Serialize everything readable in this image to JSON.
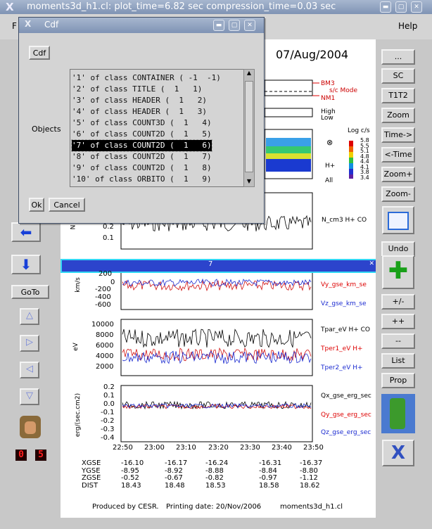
{
  "app": {
    "title": "moments3d_h1.cl: plot_time=6.82 sec  compression_time=0.03 sec"
  },
  "menubar": {
    "file_label": "F",
    "help_label": "Help"
  },
  "plot": {
    "date": "07/Aug/2004",
    "panel_tag": "7",
    "mode_labels": [
      "BM3",
      "s/c Mode",
      "NM1"
    ],
    "energy_labels": [
      "High",
      "Low"
    ],
    "spectrogram_labels": [
      "H+",
      "⊗",
      "All"
    ],
    "colorbar_title": "Log c/s",
    "colorbar_ticks": [
      "5.8",
      "5.5",
      "5.1",
      "4.8",
      "4.4",
      "4.1",
      "3.8",
      "3.4"
    ],
    "density_units": "N",
    "density_legend": "N_cm3   H+ CO",
    "vel_units": "km/s",
    "vel_legend": [
      "Vy_gse_km_se",
      "Vz_gse_km_se"
    ],
    "temp_units": "eV",
    "temp_legend": [
      "Tpar_eV  H+ CO",
      "Tper1_eV  H+",
      "Tper2_eV  H+"
    ],
    "flux_units": "erg/(sec.cm2)",
    "flux_legend": [
      "Qx_gse_erg_sec",
      "Qy_gse_erg_sec",
      "Qz_gse_erg_sec"
    ],
    "xticks": [
      "22:50",
      "23:00",
      "23:10",
      "23:20",
      "23:30",
      "23:40",
      "23:50"
    ],
    "ephem_rows": [
      {
        "label": "XGSE",
        "values": [
          "-16.10",
          "-16.17",
          "-16.24",
          "-16.31",
          "-16.37"
        ]
      },
      {
        "label": "YGSE",
        "values": [
          "-8.95",
          "-8.92",
          "-8.88",
          "-8.84",
          "-8.80"
        ]
      },
      {
        "label": "ZGSE",
        "values": [
          "-0.52",
          "-0.67",
          "-0.82",
          "-0.97",
          "-1.12"
        ]
      },
      {
        "label": "DIST",
        "values": [
          "18.43",
          "18.48",
          "18.53",
          "18.58",
          "18.62"
        ]
      }
    ],
    "footer_produced": "Produced by  CESR.",
    "footer_date": "Printing date: 20/Nov/2006",
    "footer_file": "moments3d_h1.cl"
  },
  "chart_data": [
    {
      "type": "line",
      "ylabel": "N",
      "yticks": [
        "0.2",
        "0.1"
      ]
    },
    {
      "type": "line",
      "ylabel": "km/s",
      "yticks": [
        "200",
        "0",
        "-200",
        "-400",
        "-600"
      ]
    },
    {
      "type": "line",
      "ylabel": "eV",
      "yticks": [
        "10000",
        "8000",
        "6000",
        "4000",
        "2000"
      ]
    },
    {
      "type": "line",
      "ylabel": "erg/(sec.cm2)",
      "yticks": [
        "0.2",
        "0.1",
        "0.0",
        "-0.1",
        "-0.2",
        "-0.3",
        "-0.4"
      ]
    }
  ],
  "leftcol": {
    "goto_label": "GoTo",
    "counter": [
      "0",
      "5"
    ]
  },
  "rightcol": {
    "buttons": [
      "...",
      "SC",
      "T1T2",
      "Zoom",
      "Time->",
      "<-Time",
      "Zoom+",
      "Zoom-"
    ],
    "buttons2": [
      "Undo"
    ],
    "buttons3": [
      "+/-",
      "++",
      "--",
      "List",
      "Prop"
    ]
  },
  "dialog": {
    "title": "Cdf",
    "cdf_button": "Cdf",
    "objects_label": "Objects",
    "items": [
      "'1' of class CONTAINER ( -1  -1)",
      "'2' of class TITLE (  1   1)",
      "'3' of class HEADER (  1   2)",
      "'4' of class HEADER (  1   3)",
      "'5' of class COUNT3D (  1   4)",
      "'6' of class COUNT2D (  1   5)",
      "'7' of class COUNT2D (  1   6)",
      "'8' of class COUNT2D (  1   7)",
      "'9' of class COUNT2D (  1   8)",
      "'10' of class ORBITO (  1   9)"
    ],
    "selected_index": 6,
    "ok_label": "Ok",
    "cancel_label": "Cancel"
  },
  "colors": {
    "accent": "#7f93b4",
    "blue": "#1a2ad0",
    "red": "#e01010",
    "black": "#000000"
  }
}
